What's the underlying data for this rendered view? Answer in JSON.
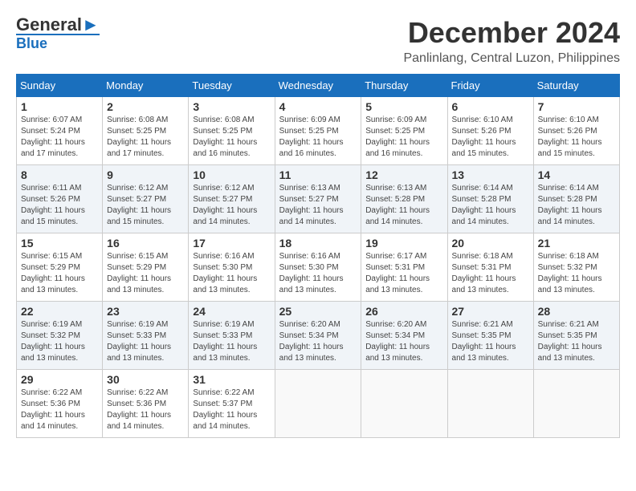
{
  "header": {
    "logo_line1": "General",
    "logo_line2": "Blue",
    "month_title": "December 2024",
    "location": "Panlinlang, Central Luzon, Philippines"
  },
  "weekdays": [
    "Sunday",
    "Monday",
    "Tuesday",
    "Wednesday",
    "Thursday",
    "Friday",
    "Saturday"
  ],
  "weeks": [
    [
      {
        "day": "1",
        "sunrise": "6:07 AM",
        "sunset": "5:24 PM",
        "daylight": "11 hours and 17 minutes."
      },
      {
        "day": "2",
        "sunrise": "6:08 AM",
        "sunset": "5:25 PM",
        "daylight": "11 hours and 17 minutes."
      },
      {
        "day": "3",
        "sunrise": "6:08 AM",
        "sunset": "5:25 PM",
        "daylight": "11 hours and 16 minutes."
      },
      {
        "day": "4",
        "sunrise": "6:09 AM",
        "sunset": "5:25 PM",
        "daylight": "11 hours and 16 minutes."
      },
      {
        "day": "5",
        "sunrise": "6:09 AM",
        "sunset": "5:25 PM",
        "daylight": "11 hours and 16 minutes."
      },
      {
        "day": "6",
        "sunrise": "6:10 AM",
        "sunset": "5:26 PM",
        "daylight": "11 hours and 15 minutes."
      },
      {
        "day": "7",
        "sunrise": "6:10 AM",
        "sunset": "5:26 PM",
        "daylight": "11 hours and 15 minutes."
      }
    ],
    [
      {
        "day": "8",
        "sunrise": "6:11 AM",
        "sunset": "5:26 PM",
        "daylight": "11 hours and 15 minutes."
      },
      {
        "day": "9",
        "sunrise": "6:12 AM",
        "sunset": "5:27 PM",
        "daylight": "11 hours and 15 minutes."
      },
      {
        "day": "10",
        "sunrise": "6:12 AM",
        "sunset": "5:27 PM",
        "daylight": "11 hours and 14 minutes."
      },
      {
        "day": "11",
        "sunrise": "6:13 AM",
        "sunset": "5:27 PM",
        "daylight": "11 hours and 14 minutes."
      },
      {
        "day": "12",
        "sunrise": "6:13 AM",
        "sunset": "5:28 PM",
        "daylight": "11 hours and 14 minutes."
      },
      {
        "day": "13",
        "sunrise": "6:14 AM",
        "sunset": "5:28 PM",
        "daylight": "11 hours and 14 minutes."
      },
      {
        "day": "14",
        "sunrise": "6:14 AM",
        "sunset": "5:28 PM",
        "daylight": "11 hours and 14 minutes."
      }
    ],
    [
      {
        "day": "15",
        "sunrise": "6:15 AM",
        "sunset": "5:29 PM",
        "daylight": "11 hours and 13 minutes."
      },
      {
        "day": "16",
        "sunrise": "6:15 AM",
        "sunset": "5:29 PM",
        "daylight": "11 hours and 13 minutes."
      },
      {
        "day": "17",
        "sunrise": "6:16 AM",
        "sunset": "5:30 PM",
        "daylight": "11 hours and 13 minutes."
      },
      {
        "day": "18",
        "sunrise": "6:16 AM",
        "sunset": "5:30 PM",
        "daylight": "11 hours and 13 minutes."
      },
      {
        "day": "19",
        "sunrise": "6:17 AM",
        "sunset": "5:31 PM",
        "daylight": "11 hours and 13 minutes."
      },
      {
        "day": "20",
        "sunrise": "6:18 AM",
        "sunset": "5:31 PM",
        "daylight": "11 hours and 13 minutes."
      },
      {
        "day": "21",
        "sunrise": "6:18 AM",
        "sunset": "5:32 PM",
        "daylight": "11 hours and 13 minutes."
      }
    ],
    [
      {
        "day": "22",
        "sunrise": "6:19 AM",
        "sunset": "5:32 PM",
        "daylight": "11 hours and 13 minutes."
      },
      {
        "day": "23",
        "sunrise": "6:19 AM",
        "sunset": "5:33 PM",
        "daylight": "11 hours and 13 minutes."
      },
      {
        "day": "24",
        "sunrise": "6:19 AM",
        "sunset": "5:33 PM",
        "daylight": "11 hours and 13 minutes."
      },
      {
        "day": "25",
        "sunrise": "6:20 AM",
        "sunset": "5:34 PM",
        "daylight": "11 hours and 13 minutes."
      },
      {
        "day": "26",
        "sunrise": "6:20 AM",
        "sunset": "5:34 PM",
        "daylight": "11 hours and 13 minutes."
      },
      {
        "day": "27",
        "sunrise": "6:21 AM",
        "sunset": "5:35 PM",
        "daylight": "11 hours and 13 minutes."
      },
      {
        "day": "28",
        "sunrise": "6:21 AM",
        "sunset": "5:35 PM",
        "daylight": "11 hours and 13 minutes."
      }
    ],
    [
      {
        "day": "29",
        "sunrise": "6:22 AM",
        "sunset": "5:36 PM",
        "daylight": "11 hours and 14 minutes."
      },
      {
        "day": "30",
        "sunrise": "6:22 AM",
        "sunset": "5:36 PM",
        "daylight": "11 hours and 14 minutes."
      },
      {
        "day": "31",
        "sunrise": "6:22 AM",
        "sunset": "5:37 PM",
        "daylight": "11 hours and 14 minutes."
      },
      null,
      null,
      null,
      null
    ]
  ],
  "labels": {
    "sunrise": "Sunrise: ",
    "sunset": "Sunset: ",
    "daylight": "Daylight: "
  }
}
